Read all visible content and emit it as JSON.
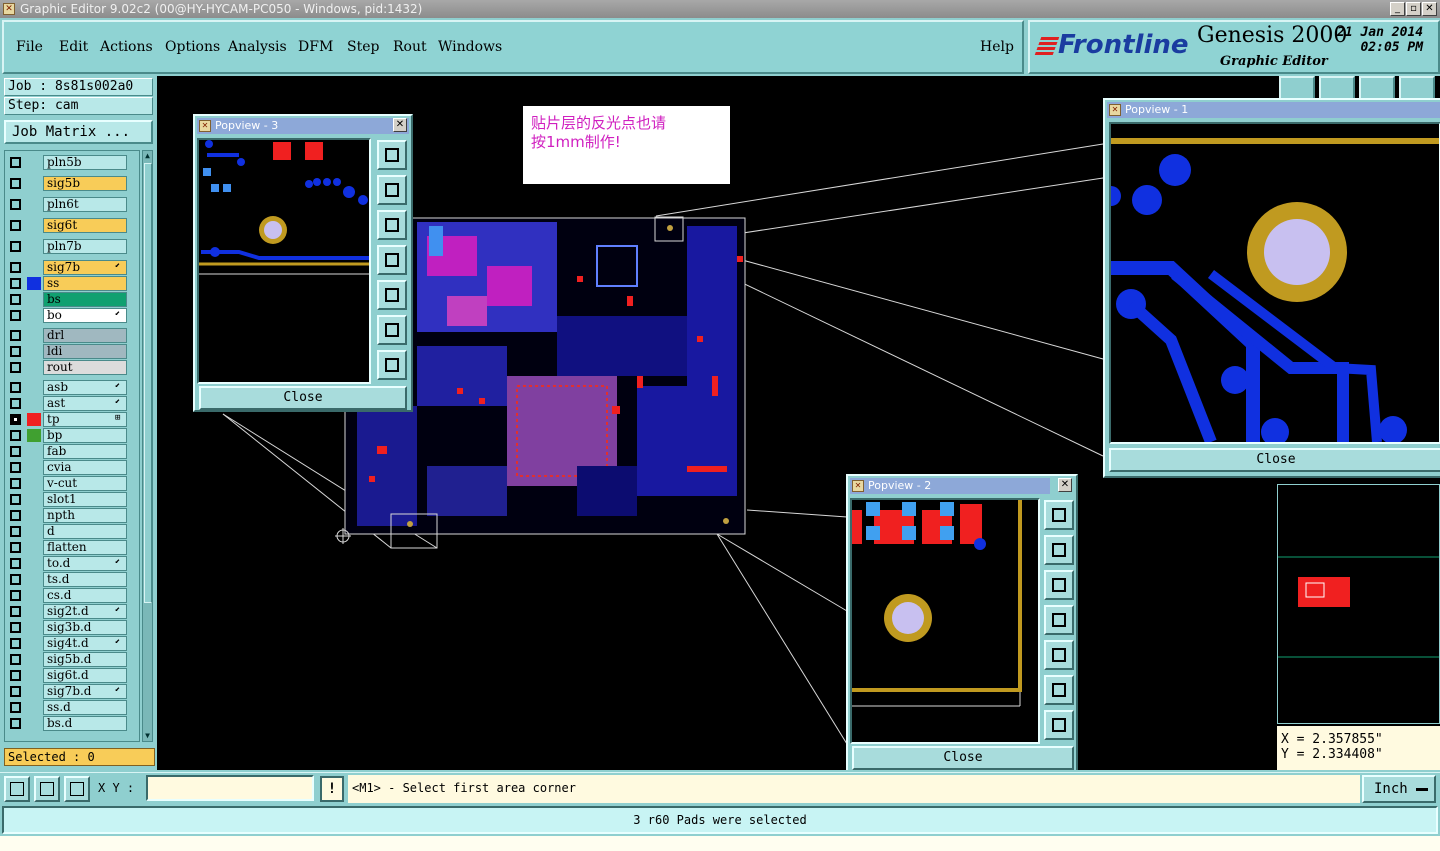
{
  "window": {
    "title": "Graphic Editor 9.02c2 (00@HY-HYCAM-PC050 - Windows, pid:1432)",
    "controls": [
      "_",
      "▫",
      "✕"
    ]
  },
  "menu": {
    "items": [
      "File",
      "Edit",
      "Actions",
      "Options",
      "Analysis",
      "DFM",
      "Step",
      "Rout",
      "Windows"
    ],
    "help": "Help"
  },
  "brand": {
    "logo": "Frontline",
    "product": "Genesis 2000",
    "subtitle": "Graphic Editor",
    "date": "21 Jan 2014",
    "time": "02:05 PM"
  },
  "left": {
    "job": "Job  : 8s81s002a0",
    "step": "Step: cam",
    "job_matrix": "Job Matrix ...",
    "selected": "Selected : 0",
    "layers": [
      {
        "name": "pln5b",
        "color": "#b8e8e8",
        "sw": "",
        "checked": false,
        "flag": ""
      },
      {
        "name": "sig5b",
        "color": "#f8cc58",
        "sw": "",
        "checked": false,
        "flag": ""
      },
      {
        "name": "pln6t",
        "color": "#b8e8e8",
        "sw": "",
        "checked": false,
        "flag": ""
      },
      {
        "name": "sig6t",
        "color": "#f8cc58",
        "sw": "",
        "checked": false,
        "flag": ""
      },
      {
        "name": "pln7b",
        "color": "#b8e8e8",
        "sw": "",
        "checked": false,
        "flag": ""
      },
      {
        "name": "sig7b",
        "color": "#f8cc58",
        "sw": "",
        "checked": false,
        "flag": "⬋"
      },
      {
        "name": "ss",
        "color": "#f8cc58",
        "sw": "#1030e0",
        "checked": false,
        "flag": ""
      },
      {
        "name": "bs",
        "color": "#10a070",
        "sw": "",
        "checked": false,
        "flag": ""
      },
      {
        "name": "bo",
        "color": "#ffffff",
        "sw": "",
        "checked": false,
        "flag": "⬋"
      },
      {
        "name": "drl",
        "color": "#a0b8c0",
        "sw": "",
        "checked": false,
        "flag": ""
      },
      {
        "name": "ldi",
        "color": "#a0b8c0",
        "sw": "",
        "checked": false,
        "flag": ""
      },
      {
        "name": "rout",
        "color": "#dcdcdc",
        "sw": "",
        "checked": false,
        "flag": ""
      },
      {
        "name": "asb",
        "color": "#b8e8e8",
        "sw": "",
        "checked": false,
        "flag": "⬋"
      },
      {
        "name": "ast",
        "color": "#b8e8e8",
        "sw": "",
        "checked": false,
        "flag": "⬋"
      },
      {
        "name": "tp",
        "color": "#b8e8e8",
        "sw": "#f02020",
        "checked": true,
        "flag": "⊞"
      },
      {
        "name": "bp",
        "color": "#b8e8e8",
        "sw": "#40a030",
        "checked": false,
        "flag": ""
      },
      {
        "name": "fab",
        "color": "#b8e8e8",
        "sw": "",
        "checked": false,
        "flag": ""
      },
      {
        "name": "cvia",
        "color": "#b8e8e8",
        "sw": "",
        "checked": false,
        "flag": ""
      },
      {
        "name": "v-cut",
        "color": "#b8e8e8",
        "sw": "",
        "checked": false,
        "flag": ""
      },
      {
        "name": "slot1",
        "color": "#b8e8e8",
        "sw": "",
        "checked": false,
        "flag": ""
      },
      {
        "name": "npth",
        "color": "#b8e8e8",
        "sw": "",
        "checked": false,
        "flag": ""
      },
      {
        "name": "d",
        "color": "#b8e8e8",
        "sw": "",
        "checked": false,
        "flag": ""
      },
      {
        "name": "flatten",
        "color": "#b8e8e8",
        "sw": "",
        "checked": false,
        "flag": ""
      },
      {
        "name": "to.d",
        "color": "#b8e8e8",
        "sw": "",
        "checked": false,
        "flag": "⬋"
      },
      {
        "name": "ts.d",
        "color": "#b8e8e8",
        "sw": "",
        "checked": false,
        "flag": ""
      },
      {
        "name": "cs.d",
        "color": "#b8e8e8",
        "sw": "",
        "checked": false,
        "flag": ""
      },
      {
        "name": "sig2t.d",
        "color": "#b8e8e8",
        "sw": "",
        "checked": false,
        "flag": "⬋"
      },
      {
        "name": "sig3b.d",
        "color": "#b8e8e8",
        "sw": "",
        "checked": false,
        "flag": ""
      },
      {
        "name": "sig4t.d",
        "color": "#b8e8e8",
        "sw": "",
        "checked": false,
        "flag": "⬋"
      },
      {
        "name": "sig5b.d",
        "color": "#b8e8e8",
        "sw": "",
        "checked": false,
        "flag": ""
      },
      {
        "name": "sig6t.d",
        "color": "#b8e8e8",
        "sw": "",
        "checked": false,
        "flag": ""
      },
      {
        "name": "sig7b.d",
        "color": "#b8e8e8",
        "sw": "",
        "checked": false,
        "flag": "⬋"
      },
      {
        "name": "ss.d",
        "color": "#b8e8e8",
        "sw": "",
        "checked": false,
        "flag": ""
      },
      {
        "name": "bs.d",
        "color": "#b8e8e8",
        "sw": "",
        "checked": false,
        "flag": ""
      }
    ]
  },
  "note": {
    "text": "贴片层的反光点也请\n按1mm制作!"
  },
  "popups": {
    "p1": {
      "title": "Popview - 1",
      "close": "Close"
    },
    "p2": {
      "title": "Popview - 2",
      "close": "Close"
    },
    "p3": {
      "title": "Popview - 3",
      "close": "Close"
    }
  },
  "coords": {
    "x": "X = 2.357855\"",
    "y": "Y = 2.334408\""
  },
  "bottom": {
    "xy_label": "X Y :",
    "xy_value": "",
    "excl": "!",
    "prompt": "<M1> - Select first area corner",
    "unit": "Inch",
    "status": "3 r60 Pads were selected"
  },
  "colors": {
    "panel": "#8fcfcf",
    "trace_blue": "#1030e0",
    "pad_red": "#f02020",
    "pad_gold": "#c09a20",
    "pad_lilac": "#c8c0f0"
  }
}
